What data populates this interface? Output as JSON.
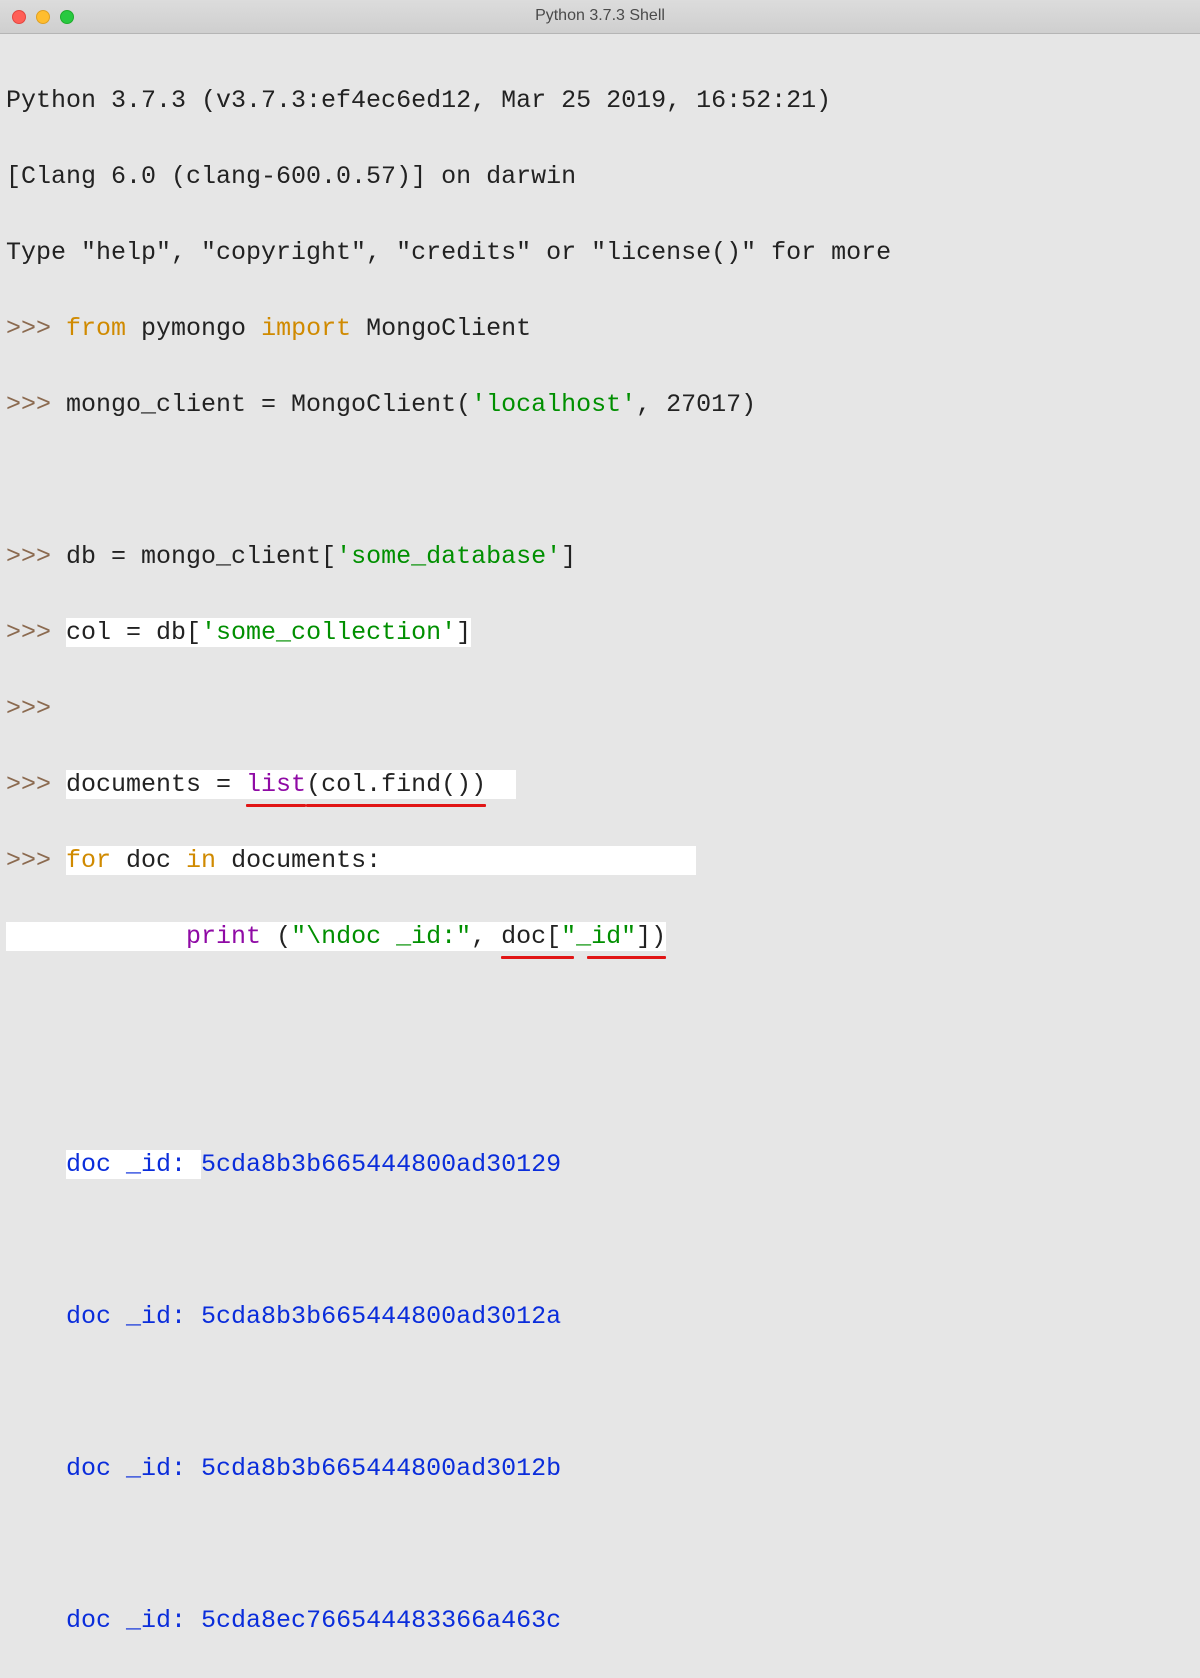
{
  "window": {
    "title": "Python 3.7.3 Shell"
  },
  "banner": {
    "line1": "Python 3.7.3 (v3.7.3:ef4ec6ed12, Mar 25 2019, 16:52:21)",
    "line2": "[Clang 6.0 (clang-600.0.57)] on darwin",
    "line3": "Type \"help\", \"copyright\", \"credits\" or \"license()\" for more"
  },
  "prompt": ">>> ",
  "code": {
    "l1": {
      "kw_from": "from",
      "mod1": " pymongo ",
      "kw_import": "import",
      "rest": " MongoClient"
    },
    "l2": {
      "pre": "mongo_client = MongoClient(",
      "str1": "'localhost'",
      "post": ", 27017)"
    },
    "l3": {
      "pre": "db = mongo_client[",
      "str1": "'some_database'",
      "post": "]"
    },
    "l4": {
      "pre": "col = db[",
      "str1": "'some_collection'",
      "post": "]"
    },
    "l5": {
      "pre": "documents = ",
      "fn": "list",
      "args": "(col.find())"
    },
    "l6": {
      "kw_for": "for",
      "mid1": " doc ",
      "kw_in": "in",
      "mid2": " documents:"
    },
    "l7": {
      "indent": "        ",
      "fn": "print",
      "paren_open": " (",
      "str1": "\"\\ndoc _id:\"",
      "comma": ", ",
      "expr_l": "doc[",
      "expr_key": "\"_id\"",
      "expr_r": "])"
    }
  },
  "output": {
    "label": "doc _id: ",
    "ids": [
      "5cda8b3b665444800ad30129",
      "5cda8b3b665444800ad3012a",
      "5cda8b3b665444800ad3012b",
      "5cda8ec766544483366a463c"
    ]
  }
}
